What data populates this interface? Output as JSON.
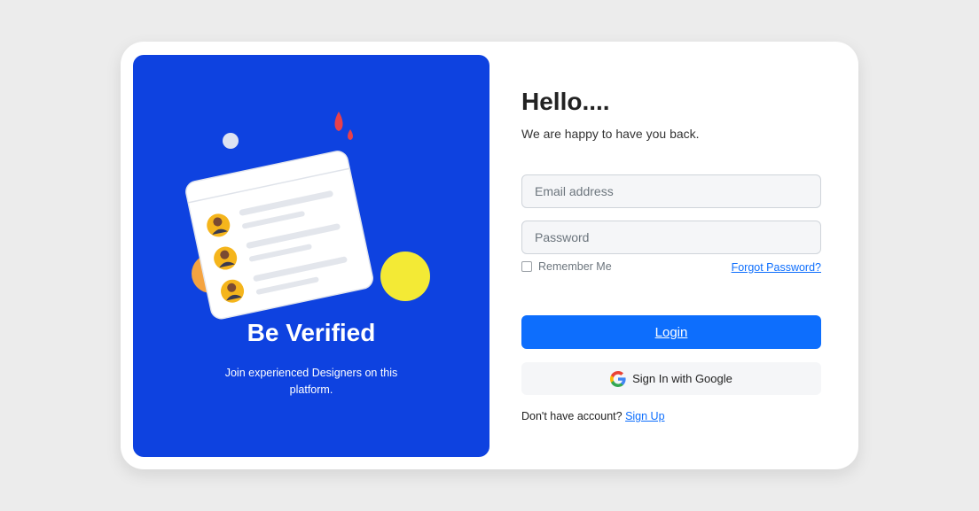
{
  "promo": {
    "title": "Be Verified",
    "subtitle": "Join experienced Designers on this platform.",
    "illustration": "verified-users-card-illustration"
  },
  "login": {
    "title": "Hello....",
    "subtitle": "We are happy to have you back.",
    "email": {
      "value": "",
      "placeholder": "Email address"
    },
    "password": {
      "value": "",
      "placeholder": "Password"
    },
    "remember_label": "Remember Me",
    "remember_checked": false,
    "forgot_label": "Forgot Password?",
    "login_label": "Login",
    "google_label": "Sign In with Google",
    "google_icon": "google-icon",
    "no_account_text": "Don't have account?",
    "signup_label": "Sign Up"
  },
  "colors": {
    "promo_bg": "#0e42e0",
    "primary": "#0d6efd",
    "page_bg": "#ececec",
    "card_bg": "#ffffff"
  }
}
